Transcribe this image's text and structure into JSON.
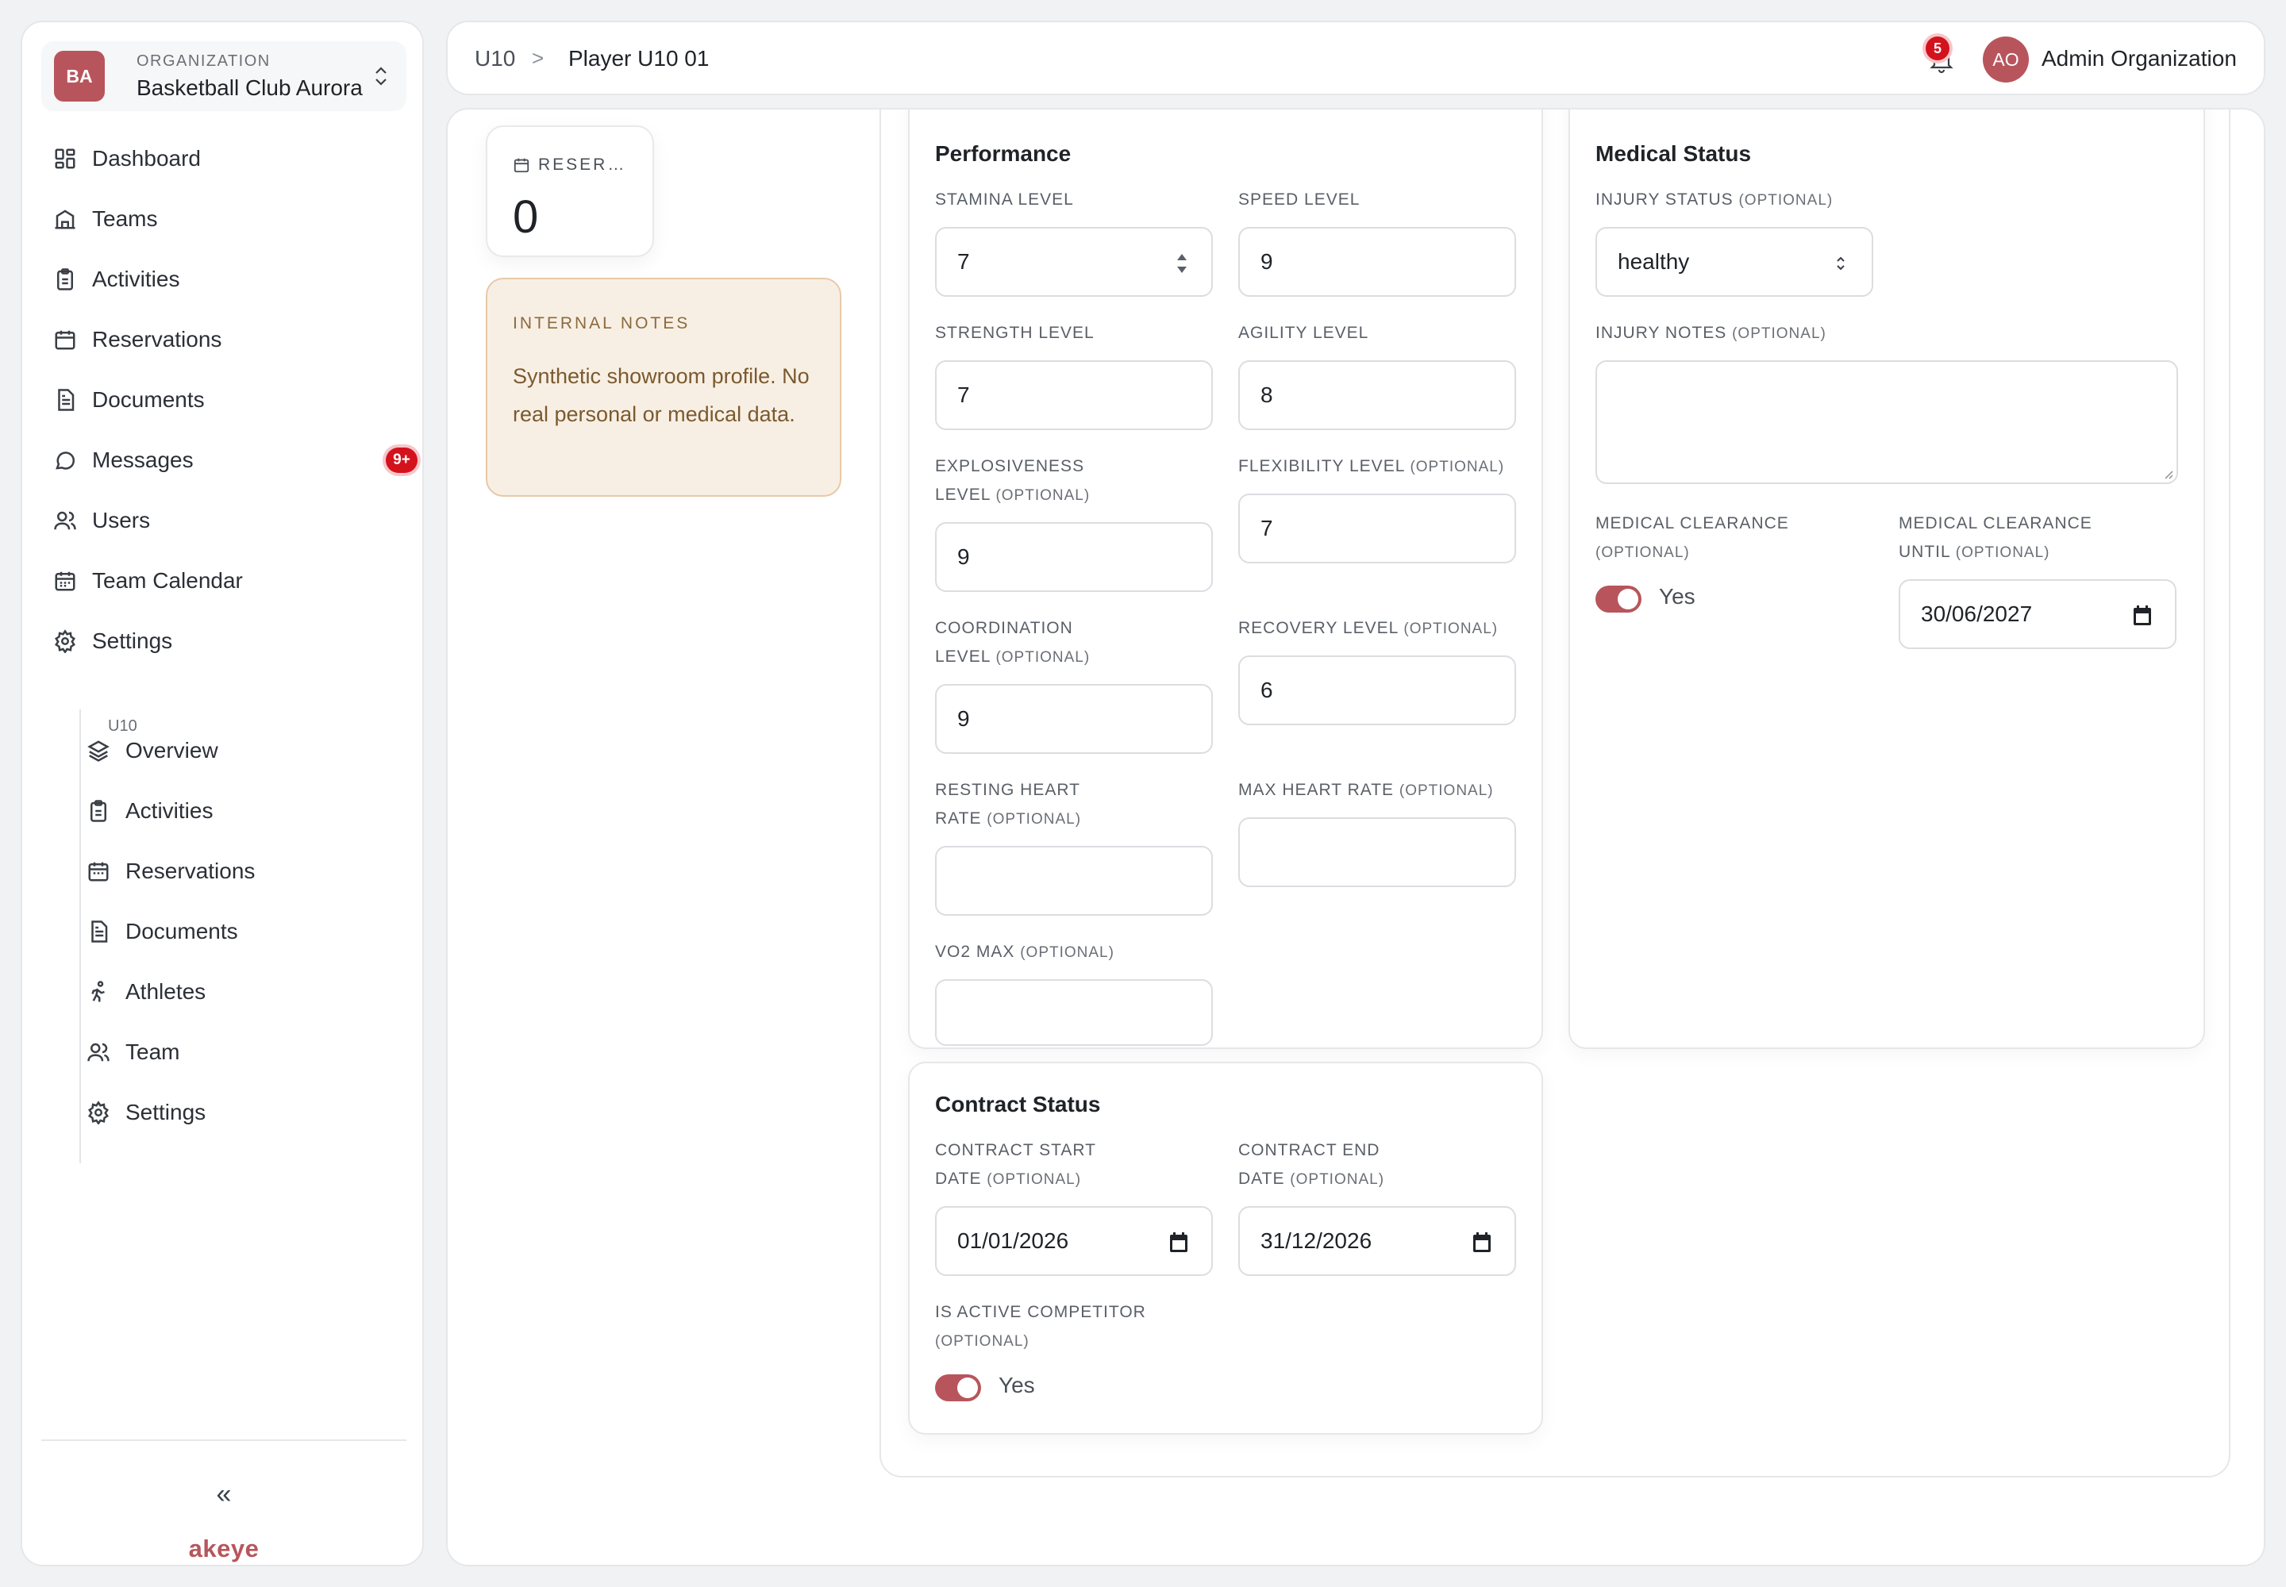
{
  "sidebar": {
    "org_avatar": "BA",
    "org_caption": "ORGANIZATION",
    "org_name": "Basketball Club Aurora",
    "items": [
      {
        "label": "Dashboard",
        "icon": "dashboard-icon"
      },
      {
        "label": "Teams",
        "icon": "teams-icon"
      },
      {
        "label": "Activities",
        "icon": "clipboard-icon"
      },
      {
        "label": "Reservations",
        "icon": "calendar-icon"
      },
      {
        "label": "Documents",
        "icon": "document-icon"
      },
      {
        "label": "Messages",
        "icon": "message-icon",
        "badge": "9+"
      },
      {
        "label": "Users",
        "icon": "users-icon"
      },
      {
        "label": "Team Calendar",
        "icon": "calendar-icon"
      },
      {
        "label": "Settings",
        "icon": "gear-icon"
      }
    ],
    "sub_title": "U10",
    "sub_items": [
      {
        "label": "Overview",
        "icon": "layers-icon"
      },
      {
        "label": "Activities",
        "icon": "clipboard-icon"
      },
      {
        "label": "Reservations",
        "icon": "calendar-icon"
      },
      {
        "label": "Documents",
        "icon": "document-icon"
      },
      {
        "label": "Athletes",
        "icon": "running-icon"
      },
      {
        "label": "Team",
        "icon": "users-icon"
      },
      {
        "label": "Settings",
        "icon": "gear-icon"
      }
    ],
    "collapse_label": "«",
    "brand": "akeye"
  },
  "topbar": {
    "breadcrumb_1": "U10",
    "breadcrumb_sep": ">",
    "breadcrumb_2": "Player U10 01",
    "notification_count": "5",
    "user_avatar": "AO",
    "user_name": "Admin Organization"
  },
  "stat": {
    "label": "RESER…",
    "value": "0"
  },
  "notes": {
    "title": "INTERNAL NOTES",
    "text": "Synthetic showroom profile. No real personal or medical data."
  },
  "performance": {
    "title": "Performance",
    "fields": {
      "stamina": {
        "label": "STAMINA LEVEL",
        "optional": "",
        "value": "7"
      },
      "speed": {
        "label": "SPEED LEVEL",
        "optional": "",
        "value": "9"
      },
      "strength": {
        "label": "STRENGTH LEVEL",
        "optional": "",
        "value": "7"
      },
      "agility": {
        "label": "AGILITY LEVEL",
        "optional": "",
        "value": "8"
      },
      "explosiveness": {
        "label": "EXPLOSIVENESS LEVEL",
        "optional": "(OPTIONAL)",
        "value": "9"
      },
      "flexibility": {
        "label": "FLEXIBILITY LEVEL",
        "optional": "(OPTIONAL)",
        "value": "7"
      },
      "coordination": {
        "label": "COORDINATION LEVEL",
        "optional": "(OPTIONAL)",
        "value": "9"
      },
      "recovery": {
        "label": "RECOVERY LEVEL",
        "optional": "(OPTIONAL)",
        "value": "6"
      },
      "resting_hr": {
        "label": "RESTING HEART RATE",
        "optional": "(OPTIONAL)",
        "value": ""
      },
      "max_hr": {
        "label": "MAX HEART RATE",
        "optional": "(OPTIONAL)",
        "value": ""
      },
      "vo2": {
        "label": "VO2 MAX",
        "optional": "(OPTIONAL)",
        "value": ""
      }
    }
  },
  "medical": {
    "title": "Medical Status",
    "injury_status_label": "INJURY STATUS",
    "injury_status_optional": "(OPTIONAL)",
    "injury_status_value": "healthy",
    "injury_notes_label": "INJURY NOTES",
    "injury_notes_optional": "(OPTIONAL)",
    "clearance_label": "MEDICAL CLEARANCE",
    "clearance_optional": "(OPTIONAL)",
    "clearance_toggle": "Yes",
    "clearance_until_label": "MEDICAL CLEARANCE UNTIL",
    "clearance_until_optional": "(OPTIONAL)",
    "clearance_until_value": "30/06/2027"
  },
  "contract": {
    "title": "Contract Status",
    "start_label": "CONTRACT START DATE",
    "start_optional": "(OPTIONAL)",
    "start_value": "01/01/2026",
    "end_label": "CONTRACT END DATE",
    "end_optional": "(OPTIONAL)",
    "end_value": "31/12/2026",
    "active_label": "IS ACTIVE COMPETITOR",
    "active_optional": "(OPTIONAL)",
    "active_toggle": "Yes"
  },
  "colors": {
    "accent": "#b8555c",
    "badge": "#d4121d",
    "notes_bg": "#f8efe4"
  }
}
